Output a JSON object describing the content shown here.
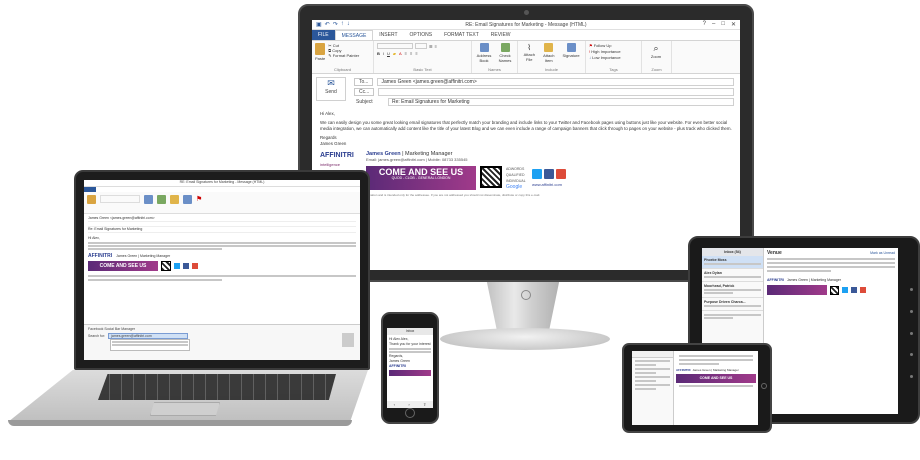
{
  "monitor": {
    "window_title": "RE: Email Signatures for Marketing - Message (HTML)",
    "tabs": [
      "FILE",
      "MESSAGE",
      "INSERT",
      "OPTIONS",
      "FORMAT TEXT",
      "REVIEW"
    ],
    "clipboard": {
      "cut": "Cut",
      "copy": "Copy",
      "format_painter": "Format Painter",
      "paste": "Paste",
      "group": "Clipboard"
    },
    "groups": {
      "basic_text": "Basic Text",
      "names": "Names",
      "include": "Include",
      "tags": "Tags",
      "zoom": "Zoom"
    },
    "ribbon": {
      "address_book": "Address Book",
      "check_names": "Check Names",
      "attach_file": "Attach File",
      "attach_item": "Attach Item",
      "signature": "Signature",
      "follow_up": "Follow Up",
      "high_importance": "High Importance",
      "low_importance": "Low Importance",
      "zoom": "Zoom"
    },
    "to_label": "To...",
    "to_value": "James Green <james.green@affinitri.com>",
    "cc_label": "Cc...",
    "send_label": "Send",
    "subject_label": "Subject",
    "subject_value": "Re: Email Signatures for Marketing",
    "greeting": "Hi Alex,",
    "body": "We can easily design you some great looking email signatures that perfectly match your branding and include links to your Twitter and Facebook pages using buttons just like your website. For even better social media integration, we can automatically add content like the title of your latest Blog and we can even include a range of campaign banners that click through to pages on your website - plus track who clicked them.",
    "closing": "Regards",
    "closing_name": "James Green",
    "sig_logo": "AFFINITRI",
    "sig_logo_sub": "intelligence",
    "sig_name": "James Green",
    "sig_role": "| Marketing Manager",
    "sig_contact": "Email: james.green@affinitri.com | Mobile: 08733 335545",
    "banner_big": "COME AND SEE US",
    "banner_small": "QUOD - CLOB - GENERAL LONDON",
    "adwords": "ADWORDS QUALIFIED INDIVIDUAL",
    "google": "Google",
    "website": "www.affinitri.com",
    "disclaimer": "This email contains confidential information and is intended only for the addressee. If you are not addressed you should not disseminate, distribute or copy this e-mail."
  },
  "laptop": {
    "window_title": "RE: Email Signatures for Marketing - Message (HTML)",
    "to_value": "James Green <james.green@affinitri.com>",
    "subject_value": "Re: Email Signatures for Marketing",
    "greeting": "Hi Alex,",
    "sig_name": "James Green | Marketing Manager",
    "banner_big": "COME AND SEE US",
    "people_pane": "Facebook Social Bar Manager",
    "search_label": "Search for:",
    "search_value": "james.green@affinitri.com"
  },
  "phone": {
    "header": "Inbox",
    "lines": [
      "Hi Alex Alex,",
      "Thank you for your interest",
      "Regards,",
      "James Green"
    ],
    "logo": "AFFINITRI"
  },
  "ipad": {
    "tab": "Inbox (54)",
    "subject": "Venue",
    "reply": "Mark as Unread",
    "senders": [
      "Phoebe Moss",
      "Alex Dylan",
      "Moorhead, Patrick",
      "Purpose Driven Charca..."
    ],
    "logo": "AFFINITRI",
    "sig": "James Green | Marketing Manager"
  },
  "tab2": {
    "logo": "AFFINITRI",
    "banner": "COME AND SEE US",
    "sig": "James Green | Marketing Manager"
  },
  "colors": {
    "outlook_blue": "#2b579a",
    "brand_purple": "#5b2a77",
    "brand_magenta": "#a03a8a",
    "brand_navy": "#2a3d8f",
    "twitter": "#1da1f2",
    "facebook": "#3b5998",
    "googleplus": "#dd4b39"
  }
}
